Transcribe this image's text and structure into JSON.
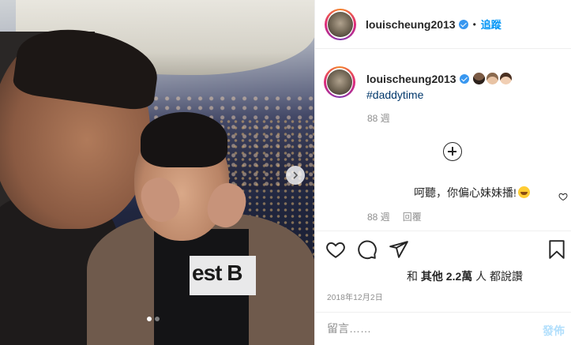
{
  "post": {
    "author": {
      "username": "louischeung2013",
      "verified": true,
      "follow_label": "追蹤",
      "separator": "•"
    },
    "carousel": {
      "current_slide": 1,
      "total_slides": 2,
      "photo_shirt_text": "est B"
    },
    "caption": {
      "username": "louischeung2013",
      "emojis": [
        "man-dark-skin-emoji",
        "man-light-skin-emoji",
        "girl-emoji"
      ],
      "hashtag": "#daddytime",
      "time": "88 週"
    },
    "comment": {
      "text": "呵聽，你偏心妹妹播!",
      "emoji": "tears-of-joy-emoji",
      "time": "88 週",
      "reply_label": "回覆"
    },
    "likes": {
      "prefix": "和",
      "other": "其他",
      "count": "2.2萬",
      "suffix": "人 都說讚"
    },
    "date": "2018年12月2日",
    "comment_input": {
      "placeholder": "留言……",
      "post_label": "發佈"
    }
  },
  "colors": {
    "link": "#0095f6",
    "hashtag": "#00376b",
    "muted": "#8e8e8e",
    "post_disabled": "#b2dffc",
    "verified": "#3897f0"
  }
}
